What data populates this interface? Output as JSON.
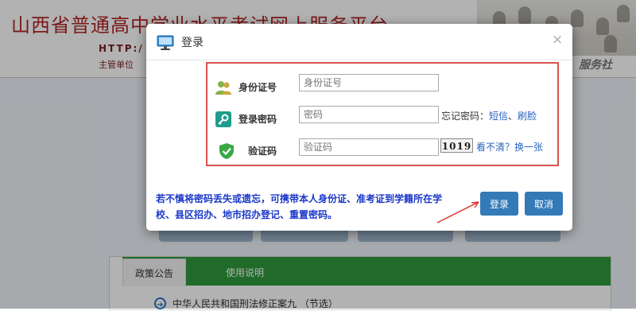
{
  "site": {
    "title": "山西省普通高中学业水平考试网上服务平台",
    "url": "HTTP:/",
    "supervisor": "主管单位",
    "nav_visible": "校　服务社"
  },
  "background": {
    "policy_tabs": [
      "政策公告",
      "使用说明"
    ],
    "policy_items": [
      "中华人民共和国刑法修正案九 （节选）"
    ]
  },
  "modal": {
    "title": "登录",
    "close_label": "×",
    "id_label": "身份证号",
    "id_placeholder": "身份证号",
    "password_label": "登录密码",
    "password_placeholder": "密码",
    "forgot_label": "忘记密码：",
    "sms_link": "短信",
    "separator": "、",
    "face_link": "刷脸",
    "captcha_label": "验证码",
    "captcha_placeholder": "验证码",
    "captcha_text": "1019",
    "captcha_refresh": "看不清？换一张",
    "notice": "若不慎将密码丢失或遗忘，可携带本人身份证、准考证到学籍所在学校、县区招办、地市招办登记、重置密码。",
    "login_button": "登录",
    "cancel_button": "取消"
  },
  "colors": {
    "brand_red": "#b02424",
    "primary_button": "#337ab7",
    "highlight_border": "#d9534f",
    "notice_blue": "#1a37c9",
    "link_blue": "#2a65c0",
    "policy_green": "#2f9a3c"
  },
  "icons": {
    "modal": "monitor-icon",
    "id_row": "user-icon",
    "password_row": "key-icon",
    "captcha_row": "shield-check-icon",
    "close": "close-icon",
    "policy_item": "arrow-right-circle-icon"
  }
}
